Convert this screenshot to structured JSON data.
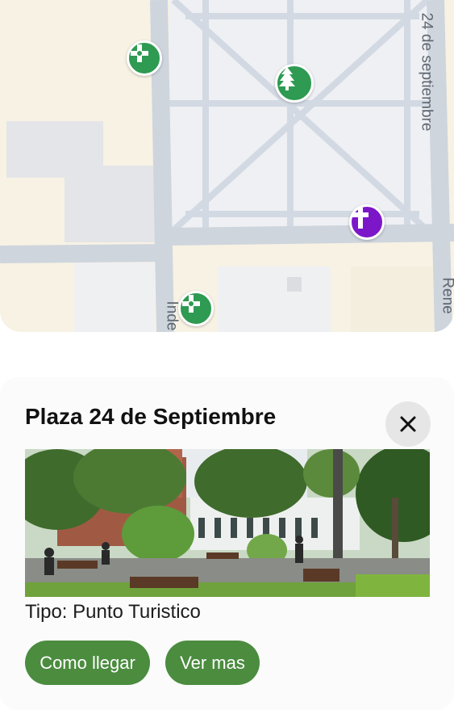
{
  "map": {
    "streets": [
      "24 de septiembre",
      "Rene",
      "Inde"
    ],
    "markers": [
      {
        "name": "pharmacy-icon",
        "color": "#2e9a52"
      },
      {
        "name": "park-tree-icon",
        "color": "#2e9a52"
      },
      {
        "name": "church-cross-icon",
        "color": "#7b17c9"
      },
      {
        "name": "pharmacy-icon",
        "color": "#2e9a52"
      }
    ]
  },
  "place": {
    "title": "Plaza 24 de Septiembre",
    "close_icon": "close-icon",
    "tipo": "Tipo: Punto Turistico",
    "buttons": {
      "directions": "Como llegar",
      "more": "Ver mas"
    },
    "accent": "#4b8c3f"
  }
}
